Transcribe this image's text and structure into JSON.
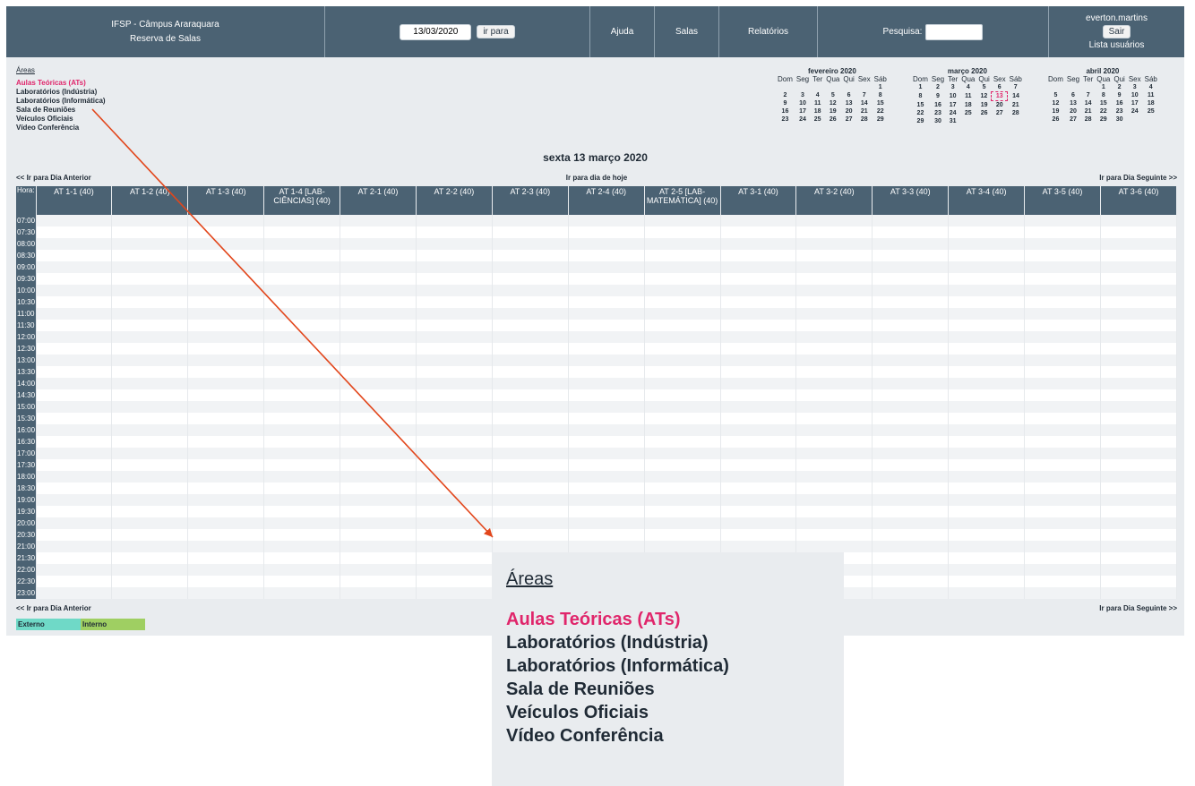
{
  "header": {
    "title_line1": "IFSP - Câmpus Araraquara",
    "title_line2": "Reserva de Salas",
    "date_value": "13/03/2020",
    "goto_label": "ir para",
    "help": "Ajuda",
    "rooms": "Salas",
    "reports": "Relatórios",
    "search_label": "Pesquisa:",
    "user": "everton.martins",
    "logout": "Sair",
    "user_list": "Lista usuários"
  },
  "areas": {
    "label": "Áreas",
    "items": [
      {
        "label": "Aulas Teóricas (ATs)",
        "selected": true
      },
      {
        "label": "Laboratórios (Indústria)",
        "selected": false
      },
      {
        "label": "Laboratórios (Informática)",
        "selected": false
      },
      {
        "label": "Sala de Reuniões",
        "selected": false
      },
      {
        "label": "Veículos Oficiais",
        "selected": false
      },
      {
        "label": "Vídeo Conferência",
        "selected": false
      }
    ]
  },
  "weekdays": [
    "Dom",
    "Seg",
    "Ter",
    "Qua",
    "Qui",
    "Sex",
    "Sáb"
  ],
  "calendars": [
    {
      "title": "fevereiro 2020",
      "weeks": [
        [
          "",
          "",
          "",
          "",
          "",
          "",
          "1"
        ],
        [
          "2",
          "3",
          "4",
          "5",
          "6",
          "7",
          "8"
        ],
        [
          "9",
          "10",
          "11",
          "12",
          "13",
          "14",
          "15"
        ],
        [
          "16",
          "17",
          "18",
          "19",
          "20",
          "21",
          "22"
        ],
        [
          "23",
          "24",
          "25",
          "26",
          "27",
          "28",
          "29"
        ]
      ],
      "today": ""
    },
    {
      "title": "março 2020",
      "weeks": [
        [
          "1",
          "2",
          "3",
          "4",
          "5",
          "6",
          "7"
        ],
        [
          "8",
          "9",
          "10",
          "11",
          "12",
          "13",
          "14"
        ],
        [
          "15",
          "16",
          "17",
          "18",
          "19",
          "20",
          "21"
        ],
        [
          "22",
          "23",
          "24",
          "25",
          "26",
          "27",
          "28"
        ],
        [
          "29",
          "30",
          "31",
          "",
          "",
          "",
          ""
        ]
      ],
      "today": "13"
    },
    {
      "title": "abril 2020",
      "weeks": [
        [
          "",
          "",
          "",
          "1",
          "2",
          "3",
          "4"
        ],
        [
          "5",
          "6",
          "7",
          "8",
          "9",
          "10",
          "11"
        ],
        [
          "12",
          "13",
          "14",
          "15",
          "16",
          "17",
          "18"
        ],
        [
          "19",
          "20",
          "21",
          "22",
          "23",
          "24",
          "25"
        ],
        [
          "26",
          "27",
          "28",
          "29",
          "30",
          "",
          ""
        ]
      ],
      "today": ""
    }
  ],
  "day_title": "sexta 13 março 2020",
  "nav": {
    "prev": "<< Ir para Dia Anterior",
    "today": "Ir para dia de hoje",
    "next": "Ir para Dia Seguinte >>"
  },
  "grid": {
    "hour_label": "Hora:",
    "rooms": [
      "AT 1-1 (40)",
      "AT 1-2 (40)",
      "AT 1-3 (40)",
      "AT 1-4 [LAB-CIÊNCIAS] (40)",
      "AT 2-1 (40)",
      "AT 2-2 (40)",
      "AT 2-3 (40)",
      "AT 2-4 (40)",
      "AT 2-5 [LAB-MATEMÁTICA] (40)",
      "AT 3-1 (40)",
      "AT 3-2 (40)",
      "AT 3-3 (40)",
      "AT 3-4 (40)",
      "AT 3-5 (40)",
      "AT 3-6 (40)"
    ],
    "times": [
      "07:00",
      "07:30",
      "08:00",
      "08:30",
      "09:00",
      "09:30",
      "10:00",
      "10:30",
      "11:00",
      "11:30",
      "12:00",
      "12:30",
      "13:00",
      "13:30",
      "14:00",
      "14:30",
      "15:00",
      "15:30",
      "16:00",
      "16:30",
      "17:00",
      "17:30",
      "18:00",
      "18:30",
      "19:00",
      "19:30",
      "20:00",
      "20:30",
      "21:00",
      "21:30",
      "22:00",
      "22:30",
      "23:00"
    ]
  },
  "legend": [
    {
      "label": "Externo",
      "color": "#6fd9c7"
    },
    {
      "label": "Interno",
      "color": "#9fcf62"
    }
  ],
  "colors": {
    "header": "#4b6273",
    "accent": "#e0266b",
    "arrow": "#e2461b"
  }
}
